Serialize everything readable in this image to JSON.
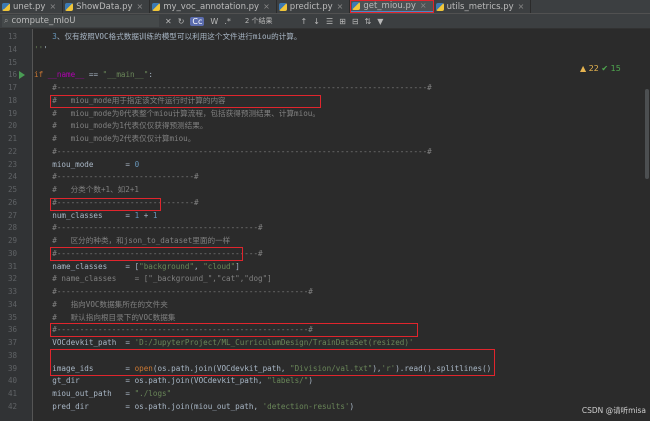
{
  "tabs": [
    {
      "label": "unet.py"
    },
    {
      "label": "ShowData.py"
    },
    {
      "label": "my_voc_annotation.py"
    },
    {
      "label": "predict.py"
    },
    {
      "label": "get_miou.py",
      "active": true
    },
    {
      "label": "utils_metrics.py"
    }
  ],
  "findbar": {
    "query": "compute_mIoU",
    "case_btn": "Cc",
    "word_btn": "W",
    "regex_btn": ".*",
    "matches": "2 个结果"
  },
  "inspections": {
    "warnings": "▲ 22",
    "weak": "✔ 15"
  },
  "lines": [
    {
      "n": "13",
      "text": "    3、仅有按照VOC格式数据训练的模型可以利用这个文件进行miou的计算。"
    },
    {
      "n": "14",
      "text": "'''"
    },
    {
      "n": "15",
      "text": ""
    },
    {
      "n": "16",
      "text": "if __name__ == \"__main__\":"
    },
    {
      "n": "17",
      "text": "    #---------------------------------------------------------------------------------#"
    },
    {
      "n": "18",
      "text": "    #   miou_mode用于指定该文件运行时计算的内容"
    },
    {
      "n": "19",
      "text": "    #   miou_mode为0代表整个miou计算流程，包括获得预测结果、计算miou。"
    },
    {
      "n": "20",
      "text": "    #   miou_mode为1代表仅仅获得预测结果。"
    },
    {
      "n": "21",
      "text": "    #   miou_mode为2代表仅仅计算miou。"
    },
    {
      "n": "22",
      "text": "    #---------------------------------------------------------------------------------#"
    },
    {
      "n": "23",
      "text": "    miou_mode       = 0"
    },
    {
      "n": "24",
      "text": "    #------------------------------#"
    },
    {
      "n": "25",
      "text": "    #   分类个数+1、如2+1"
    },
    {
      "n": "26",
      "text": "    #------------------------------#"
    },
    {
      "n": "27",
      "text": "    num_classes     = 1 + 1"
    },
    {
      "n": "28",
      "text": "    #--------------------------------------------#"
    },
    {
      "n": "29",
      "text": "    #   区分的种类，和json_to_dataset里面的一样"
    },
    {
      "n": "30",
      "text": "    #--------------------------------------------#"
    },
    {
      "n": "31",
      "text": "    name_classes    = [\"background\", \"cloud\"]"
    },
    {
      "n": "32",
      "text": "    # name_classes    = [\"_background_\",\"cat\",\"dog\"]"
    },
    {
      "n": "33",
      "text": "    #-------------------------------------------------------#"
    },
    {
      "n": "34",
      "text": "    #   指向VOC数据集所在的文件夹"
    },
    {
      "n": "35",
      "text": "    #   默认指向根目录下的VOC数据集"
    },
    {
      "n": "36",
      "text": "    #-------------------------------------------------------#"
    },
    {
      "n": "37",
      "text": "    VOCdevkit_path  = 'D:/JupyterProject/ML_CurriculumDesign/TrainDataSet(resized)'"
    },
    {
      "n": "38",
      "text": ""
    },
    {
      "n": "39",
      "text": "    image_ids       = open(os.path.join(VOCdevkit_path, \"Division/val.txt\"),'r').read().splitlines()"
    },
    {
      "n": "40",
      "text": "    gt_dir          = os.path.join(VOCdevkit_path, \"labels/\")"
    },
    {
      "n": "41",
      "text": "    miou_out_path   = \"./logs\""
    },
    {
      "n": "42",
      "text": "    pred_dir        = os.path.join(miou_out_path, 'detection-results')"
    }
  ],
  "colors": {
    "highlight_box": "#e0252d",
    "bg": "#2b2b2b",
    "accent": "#4a88c7"
  },
  "watermark": "CSDN @请听misa"
}
